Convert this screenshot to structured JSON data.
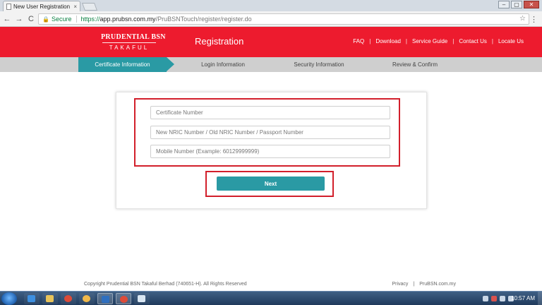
{
  "browser": {
    "tab_title": "New User Registration |",
    "tab_close": "×",
    "window_buttons": {
      "minimize": "–",
      "maximize": "▢",
      "close": "✕"
    },
    "nav": {
      "back": "←",
      "forward": "→",
      "reload": "C"
    },
    "address": {
      "security_label": "Secure",
      "scheme": "https://",
      "host": "app.prubsn.com.my",
      "path": "/PruBSNTouch/register/register.do"
    },
    "star_icon": "☆",
    "menu_icon": "⋮"
  },
  "header": {
    "logo_main": "PRUDENTIAL BSN",
    "logo_sub": "TAKAFUL",
    "title": "Registration",
    "nav": [
      "FAQ",
      "Download",
      "Service Guide",
      "Contact Us",
      "Locate Us"
    ],
    "nav_divider": "|"
  },
  "steps": [
    {
      "label": "Certificate Information",
      "active": true
    },
    {
      "label": "Login Information",
      "active": false
    },
    {
      "label": "Security Information",
      "active": false
    },
    {
      "label": "Review & Confirm",
      "active": false
    }
  ],
  "form": {
    "certificate_placeholder": "Certificate Number",
    "nric_placeholder": "New NRIC Number / Old NRIC Number / Passport Number",
    "mobile_placeholder": "Mobile Number (Example: 60129999999)",
    "next_label": "Next"
  },
  "footer": {
    "copyright": "Copyright Prudential BSN Takaful Berhad (740651-H). All Rights Reserved",
    "links": [
      "Privacy",
      "PruBSN.com.my"
    ],
    "divider": "|"
  },
  "taskbar": {
    "clock": "10:57 AM",
    "items": [
      "ie-icon",
      "explorer-icon",
      "chrome-icon",
      "paint-icon",
      "outlook-icon",
      "chrome-icon",
      "notepad-icon"
    ]
  },
  "colors": {
    "brand_red": "#ed1b2e",
    "accent_teal": "#2a9aa4",
    "highlight_red": "#d21f2b"
  }
}
